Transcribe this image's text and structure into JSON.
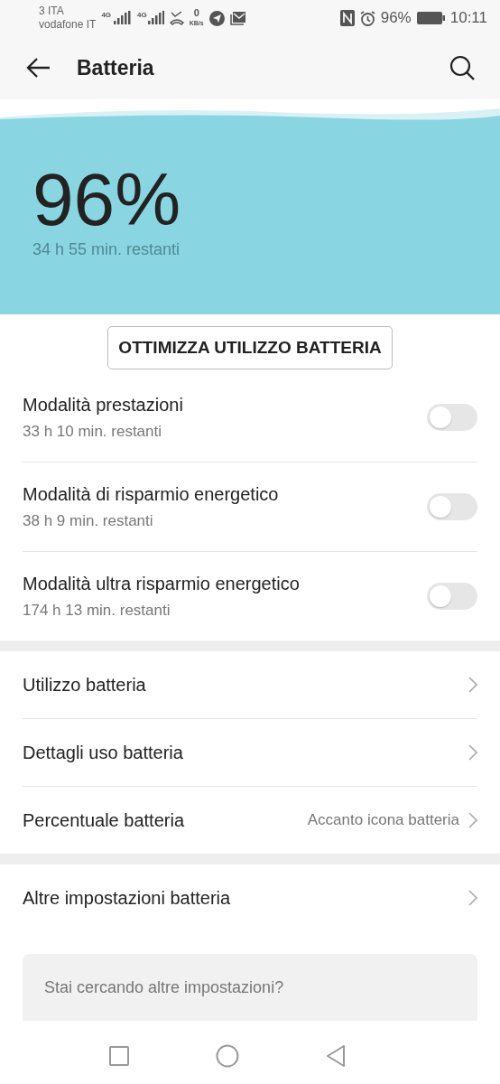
{
  "status_bar": {
    "carrier_1": "3 ITA",
    "carrier_2": "vodafone IT",
    "network_1": "4G",
    "network_2": "4G",
    "speed_value": "0",
    "speed_unit": "KB/s",
    "battery": "96%",
    "time": "10:11"
  },
  "app_bar": {
    "title": "Batteria"
  },
  "battery": {
    "percent": "96%",
    "remaining": "34 h 55 min. restanti"
  },
  "optimize_button": "OTTIMIZZA UTILIZZO BATTERIA",
  "modes": [
    {
      "title": "Modalità prestazioni",
      "subtitle": "33 h 10 min. restanti",
      "on": false
    },
    {
      "title": "Modalità di risparmio energetico",
      "subtitle": "38 h 9 min. restanti",
      "on": false
    },
    {
      "title": "Modalità ultra risparmio energetico",
      "subtitle": "174 h 13 min. restanti",
      "on": false
    }
  ],
  "settings": [
    {
      "label": "Utilizzo batteria"
    },
    {
      "label": "Dettagli uso batteria"
    },
    {
      "label": "Percentuale batteria",
      "value": "Accanto icona batteria"
    }
  ],
  "more_settings": [
    {
      "label": "Altre impostazioni batteria"
    }
  ],
  "search": {
    "placeholder": "Stai cercando altre impostazioni?"
  }
}
